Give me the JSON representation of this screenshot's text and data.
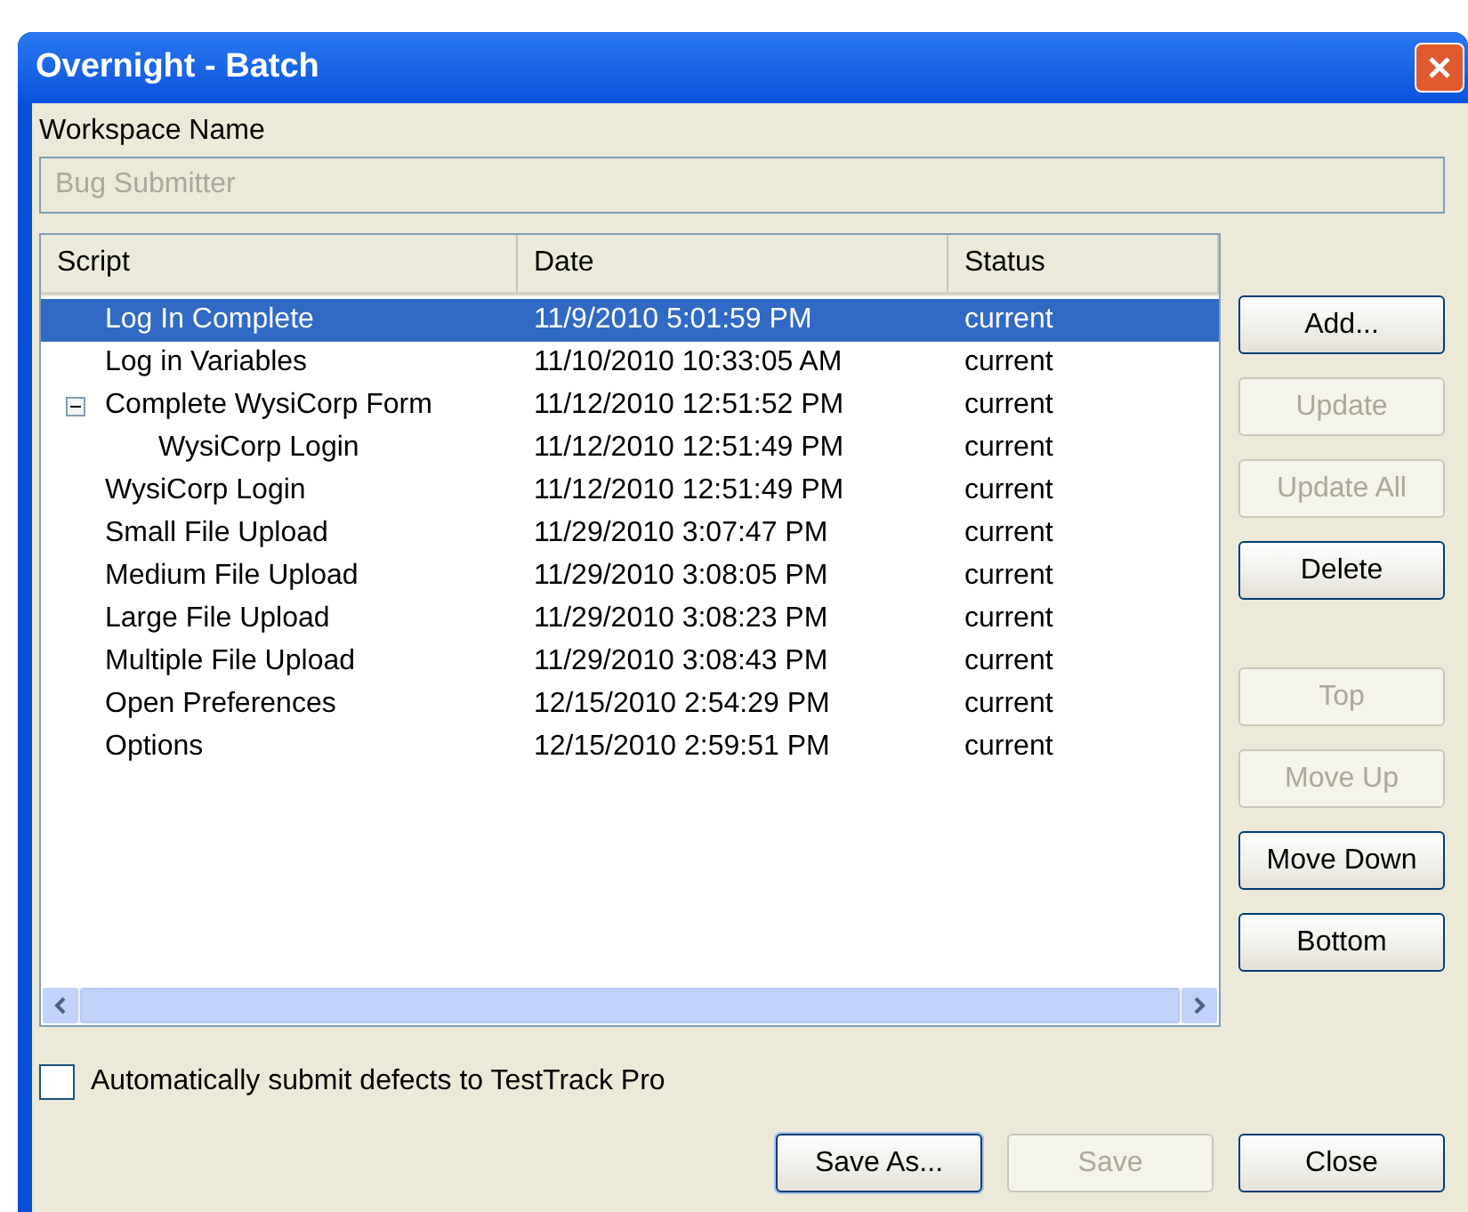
{
  "window": {
    "title": "Overnight - Batch"
  },
  "workspace": {
    "label": "Workspace Name",
    "value": "Bug Submitter",
    "disabled": true
  },
  "table": {
    "columns": [
      "Script",
      "Date",
      "Status"
    ],
    "rows": [
      {
        "script": "Log In Complete",
        "date": "11/9/2010 5:01:59 PM",
        "status": "current",
        "selected": true
      },
      {
        "script": "Log in Variables",
        "date": "11/10/2010 10:33:05 AM",
        "status": "current",
        "selected": false
      },
      {
        "script": "Complete WysiCorp Form",
        "date": "11/12/2010 12:51:52 PM",
        "status": "current",
        "selected": false,
        "expanded": true,
        "children": [
          {
            "script": "WysiCorp Login",
            "date": "11/12/2010 12:51:49 PM",
            "status": "current",
            "selected": false
          }
        ]
      },
      {
        "script": "WysiCorp Login",
        "date": "11/12/2010 12:51:49 PM",
        "status": "current",
        "selected": false
      },
      {
        "script": "Small File Upload",
        "date": "11/29/2010 3:07:47 PM",
        "status": "current",
        "selected": false
      },
      {
        "script": "Medium File Upload",
        "date": "11/29/2010 3:08:05 PM",
        "status": "current",
        "selected": false
      },
      {
        "script": "Large File Upload",
        "date": "11/29/2010 3:08:23 PM",
        "status": "current",
        "selected": false
      },
      {
        "script": "Multiple File Upload",
        "date": "11/29/2010 3:08:43 PM",
        "status": "current",
        "selected": false
      },
      {
        "script": "Open Preferences",
        "date": "12/15/2010 2:54:29 PM",
        "status": "current",
        "selected": false
      },
      {
        "script": "Options",
        "date": "12/15/2010 2:59:51 PM",
        "status": "current",
        "selected": false
      }
    ]
  },
  "side_button_groups": [
    {
      "buttons": [
        {
          "label": "Add...",
          "disabled": false
        },
        {
          "label": "Update",
          "disabled": true
        },
        {
          "label": "Update All",
          "disabled": true
        },
        {
          "label": "Delete",
          "disabled": false
        }
      ]
    },
    {
      "buttons": [
        {
          "label": "Top",
          "disabled": true
        },
        {
          "label": "Move Up",
          "disabled": true
        },
        {
          "label": "Move Down",
          "disabled": false
        },
        {
          "label": "Bottom",
          "disabled": false
        }
      ]
    }
  ],
  "auto_submit": {
    "label": "Automatically submit defects to TestTrack Pro",
    "checked": false
  },
  "buttons": [
    {
      "label": "Save As...",
      "disabled": false,
      "default": true
    },
    {
      "label": "Save",
      "disabled": true,
      "default": false
    },
    {
      "label": "Close",
      "disabled": false,
      "default": false
    }
  ]
}
